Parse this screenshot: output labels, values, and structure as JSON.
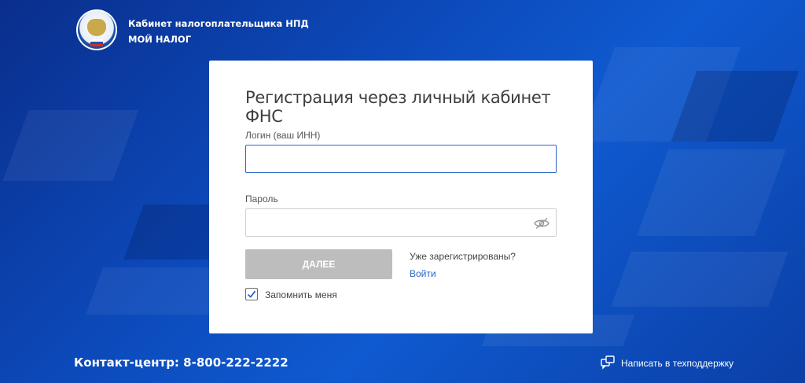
{
  "header": {
    "title": "Кабинет налогоплательщика НПД",
    "subtitle": "МОЙ НАЛОГ",
    "logo_icon": "fns-emblem"
  },
  "form": {
    "title": "Регистрация через личный кабинет ФНС",
    "login_label": "Логин (ваш ИНН)",
    "login_value": "",
    "password_label": "Пароль",
    "password_value": "",
    "password_toggle_icon": "eye-off-icon",
    "submit_label": "ДАЛЕЕ",
    "already_registered": "Уже зарегистрированы?",
    "login_link": "Войти",
    "remember_label": "Запомнить меня",
    "remember_checked": true
  },
  "footer": {
    "contact": "Контакт-центр: 8-800-222-2222",
    "support_label": "Написать в техподдержку",
    "support_icon": "chat-icon"
  },
  "colors": {
    "accent": "#2a64c5",
    "button_disabled": "#bdbdbd",
    "background": "#0c48b8"
  }
}
